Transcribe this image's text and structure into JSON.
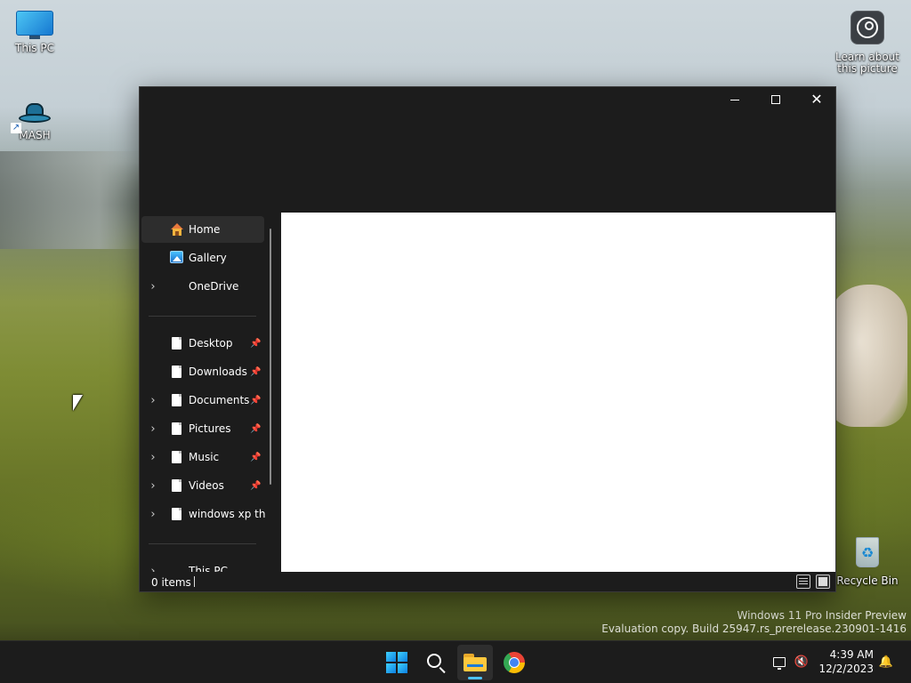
{
  "desktop": {
    "icons": {
      "this_pc": "This PC",
      "mash": "MASH",
      "learn_line1": "Learn about",
      "learn_line2": "this picture",
      "recycle_bin": "Recycle Bin"
    },
    "watermark": {
      "line1": "Windows 11 Pro Insider Preview",
      "line2": "Evaluation copy. Build 25947.rs_prerelease.230901-1416"
    }
  },
  "explorer": {
    "caption_buttons": {
      "minimize": "minimize",
      "maximize": "maximize",
      "close": "✕"
    },
    "nav": {
      "items": [
        {
          "label": "Home",
          "icon": "home-icon",
          "expandable": false,
          "pinned": false,
          "selected": true
        },
        {
          "label": "Gallery",
          "icon": "gallery-icon",
          "expandable": false,
          "pinned": false,
          "selected": false
        },
        {
          "label": "OneDrive",
          "icon": "",
          "expandable": true,
          "pinned": false,
          "selected": false
        },
        {
          "label": "Desktop",
          "icon": "document-icon",
          "expandable": false,
          "pinned": true,
          "selected": false
        },
        {
          "label": "Downloads",
          "icon": "document-icon",
          "expandable": false,
          "pinned": true,
          "selected": false
        },
        {
          "label": "Documents",
          "icon": "document-icon",
          "expandable": true,
          "pinned": true,
          "selected": false
        },
        {
          "label": "Pictures",
          "icon": "document-icon",
          "expandable": true,
          "pinned": true,
          "selected": false
        },
        {
          "label": "Music",
          "icon": "document-icon",
          "expandable": true,
          "pinned": true,
          "selected": false
        },
        {
          "label": "Videos",
          "icon": "document-icon",
          "expandable": true,
          "pinned": true,
          "selected": false
        },
        {
          "label": "windows xp thir",
          "icon": "document-icon",
          "expandable": true,
          "pinned": false,
          "selected": false
        },
        {
          "label": "This PC",
          "icon": "",
          "expandable": true,
          "pinned": false,
          "selected": false
        }
      ],
      "chevron": "›",
      "pin_glyph": "📌"
    },
    "status": {
      "item_count": "0 items"
    }
  },
  "taskbar": {
    "apps": [
      "start",
      "search",
      "file-explorer",
      "chrome"
    ],
    "clock": {
      "time": "4:39 AM",
      "date": "12/2/2023"
    },
    "tray": {
      "volume_glyph": "🔇",
      "bell_glyph": "🔔"
    }
  },
  "colors": {
    "taskbar_bg": "#1c1c1c",
    "window_bg": "#202020",
    "accent": "#4cc2ff"
  }
}
